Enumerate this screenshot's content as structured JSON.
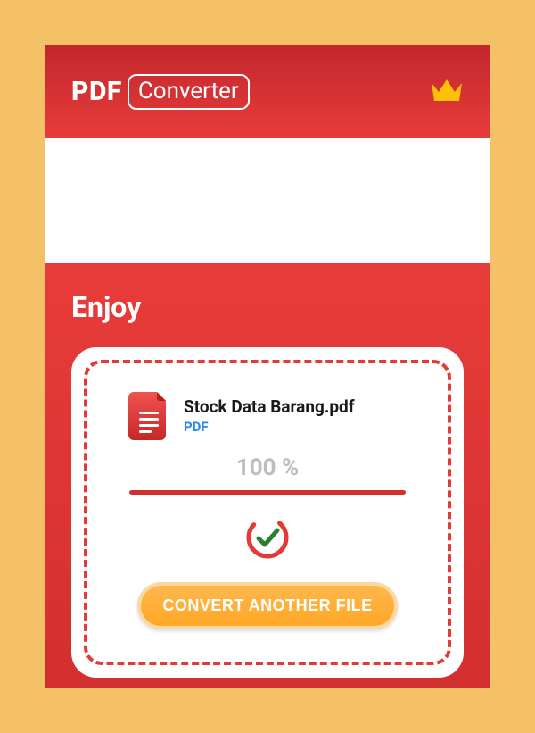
{
  "header": {
    "logo_pdf": "PDF",
    "logo_converter": "Converter"
  },
  "main": {
    "heading": "Enjoy",
    "file": {
      "name": "Stock Data Barang.pdf",
      "type_label": "PDF"
    },
    "progress_label": "100 %",
    "convert_button_label": "CONVERT ANOTHER FILE"
  },
  "icons": {
    "crown": "crown-icon",
    "document": "document-icon",
    "check": "checkmark-icon"
  },
  "colors": {
    "accent_red": "#e53935",
    "accent_orange": "#ffa726",
    "link_blue": "#1e88e5",
    "gold": "#ffc107"
  }
}
